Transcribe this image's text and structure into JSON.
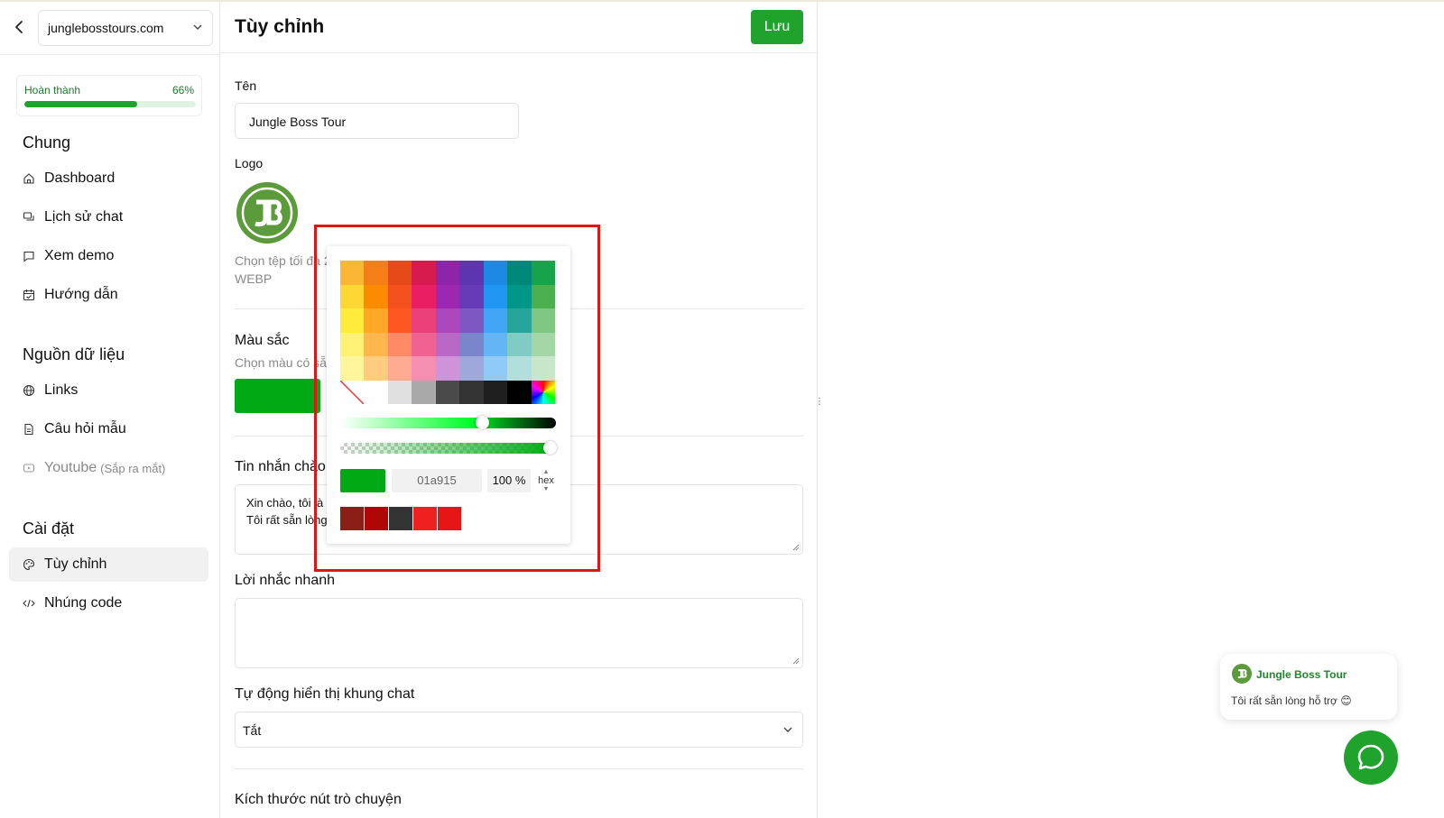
{
  "sidebar": {
    "site": "junglebosstours.com",
    "progress": {
      "label": "Hoàn thành",
      "percent_text": "66%",
      "value": 0.66
    },
    "sections": [
      {
        "title": "Chung",
        "items": [
          {
            "label": "Dashboard",
            "icon": "home-icon"
          },
          {
            "label": "Lịch sử chat",
            "icon": "chat-history-icon"
          },
          {
            "label": "Xem demo",
            "icon": "message-icon"
          },
          {
            "label": "Hướng dẫn",
            "icon": "calendar-icon"
          }
        ]
      },
      {
        "title": "Nguồn dữ liệu",
        "items": [
          {
            "label": "Links",
            "icon": "globe-icon"
          },
          {
            "label": "Câu hỏi mẫu",
            "icon": "document-icon"
          },
          {
            "label": "Youtube",
            "suffix": "(Sắp ra mắt)",
            "icon": "youtube-icon"
          }
        ]
      },
      {
        "title": "Cài đặt",
        "items": [
          {
            "label": "Tùy chỉnh",
            "icon": "palette-icon",
            "active": true
          },
          {
            "label": "Nhúng code",
            "icon": "code-icon"
          }
        ]
      }
    ]
  },
  "main": {
    "title": "Tùy chỉnh",
    "save_label": "Lưu",
    "name_label": "Tên",
    "name_value": "Jungle Boss Tour",
    "logo_label": "Logo",
    "logo_hint_line1": "Chọn tệp tối đa 2",
    "logo_hint_line2": "WEBP",
    "color_label": "Màu sắc",
    "color_hint": "Chọn màu có sẵ",
    "greeting_label": "Tin nhắn chào",
    "greeting_line1": "Xin chào, tôi là",
    "greeting_line2": "Tôi rất sẵn lòng",
    "quick_label": "Lời nhắc nhanh",
    "auto_label": "Tự động hiển thị khung chat",
    "auto_value": "Tắt",
    "size_label": "Kích thước nút trò chuyện"
  },
  "picker": {
    "swatches": [
      [
        "#fbb734",
        "#f57f17",
        "#e64a19",
        "#d81b4f",
        "#8e24aa",
        "#5e35b1",
        "#1e88e5",
        "#00897b",
        "#16a34a"
      ],
      [
        "#fdd835",
        "#fb8c00",
        "#f4511e",
        "#e91e63",
        "#9c27b0",
        "#673ab7",
        "#2196f3",
        "#009688",
        "#4caf50"
      ],
      [
        "#ffeb3b",
        "#ffa726",
        "#ff5722",
        "#ec407a",
        "#ab47bc",
        "#7e57c2",
        "#42a5f5",
        "#26a69a",
        "#81c784"
      ],
      [
        "#fff176",
        "#ffb74d",
        "#ff8a65",
        "#f06292",
        "#ba68c8",
        "#7986cb",
        "#64b5f6",
        "#80cbc4",
        "#a5d6a7"
      ],
      [
        "#fff59d",
        "#ffcc80",
        "#ffab91",
        "#f48fb1",
        "#ce93d8",
        "#9fa8da",
        "#90caf9",
        "#b2dfdb",
        "#c8e6c9"
      ],
      [
        "none",
        "#ffffff",
        "#e0e0e0",
        "#a9a9a9",
        "#4a4a4a",
        "#333333",
        "#1f1f1f",
        "#000000",
        "rainbow"
      ]
    ],
    "hue_position": 0.66,
    "alpha_position": 1.0,
    "current_color": "#01a915",
    "hex_value": "01a915",
    "alpha_value": "100 %",
    "mode": "hex",
    "recent_colors": [
      "#8b1f18",
      "#b10606",
      "#333333",
      "#ef2020",
      "#e61616"
    ]
  },
  "preview": {
    "bot_name": "Jungle Boss Tour",
    "message": "Tôi rất sẵn lòng hỗ trợ 😊",
    "accent": "#1fa32c"
  }
}
